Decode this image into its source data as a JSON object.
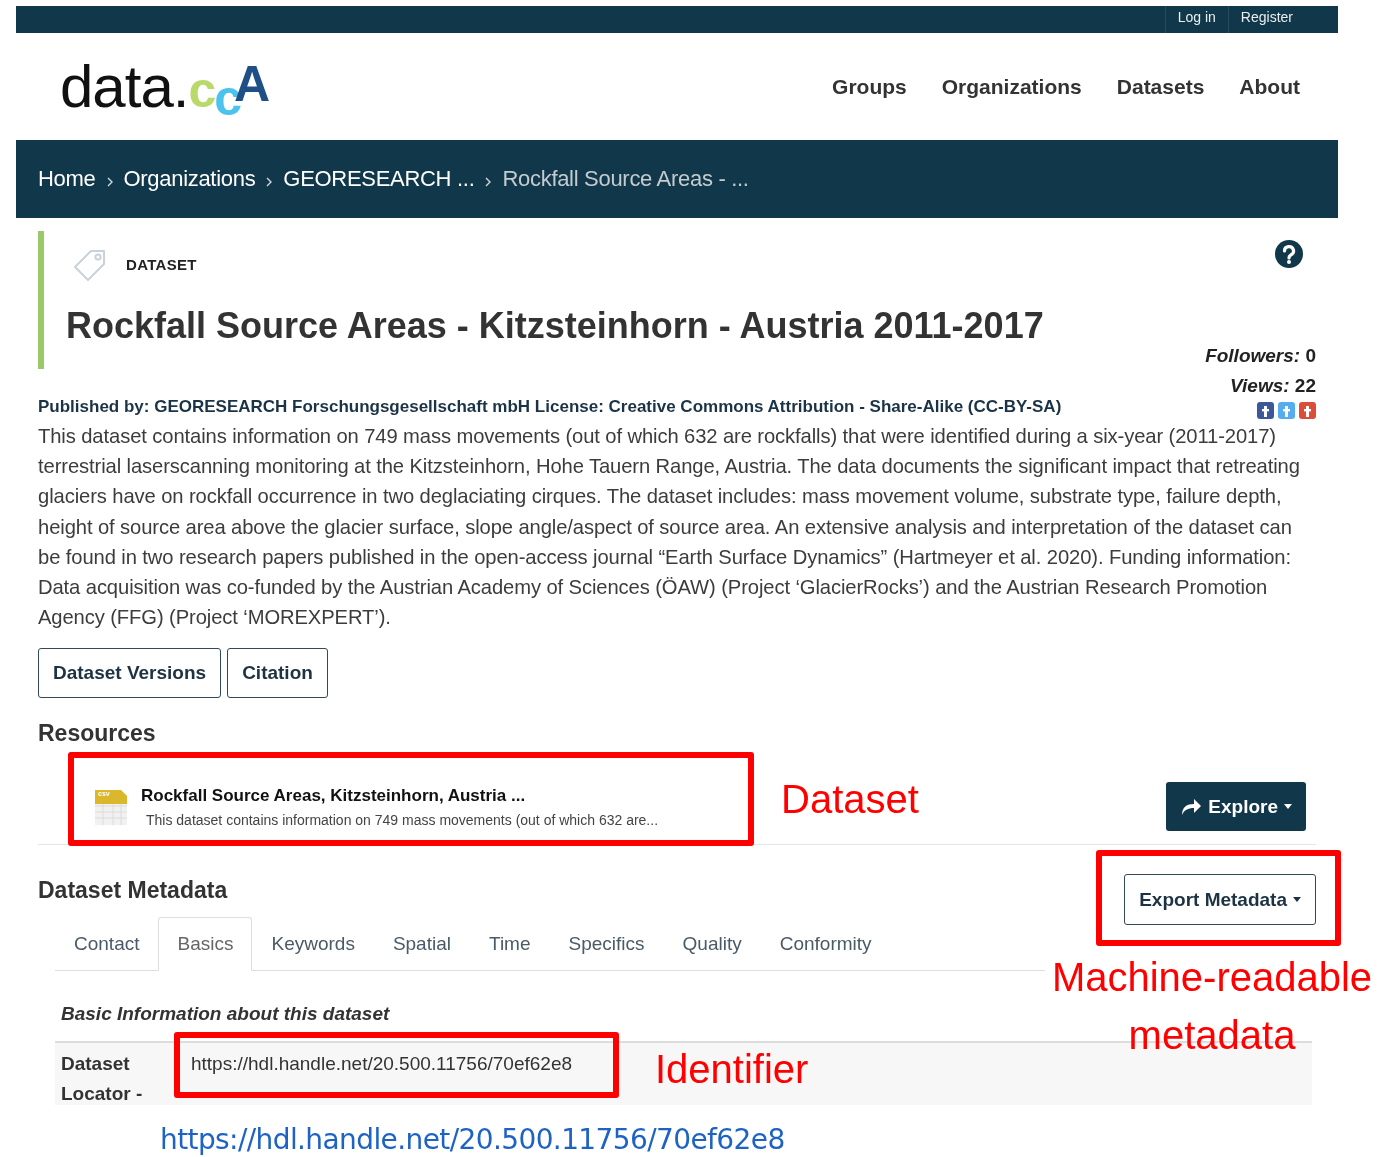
{
  "top_bar": {
    "links": [
      "Log in",
      "Register"
    ]
  },
  "header": {
    "logo": {
      "text": "data.",
      "mark": "ccA"
    },
    "nav": [
      "Groups",
      "Organizations",
      "Datasets",
      "About"
    ]
  },
  "breadcrumb": [
    {
      "label": "Home",
      "current": false
    },
    {
      "label": "Organizations",
      "current": false
    },
    {
      "label": "GEORESEARCH ...",
      "current": false
    },
    {
      "label": "Rockfall Source Areas - ...",
      "current": true
    }
  ],
  "dataset": {
    "type_label": "DATASET",
    "title": "Rockfall Source Areas - Kitzsteinhorn - Austria 2011-2017",
    "stats": [
      "*Followers:* 0",
      "*Views:* 22"
    ],
    "published": "Published by: GEORESEARCH Forschungsgesellschaft mbH License: Creative Commons Attribution - Share-Alike (CC-BY-SA)",
    "description": "This dataset contains information on 749 mass movements (out of which 632 are rockfalls) that were identified during a six-year (2011-2017) terrestrial laserscanning monitoring at the Kitzsteinhorn, Hohe Tauern Range, Austria. The data documents the significant impact that retreating glaciers have on rockfall occurrence in two deglaciating cirques. The dataset includes: mass movement volume, substrate type, failure depth, height of source area above the glacier surface, slope angle/aspect of source area. An extensive analysis and interpretation of the dataset can be found in two research papers published in the open-access journal “Earth Surface Dynamics” (Hartmeyer et al. 2020). Funding information: Data acquisition was co-funded by the Austrian Academy of Sciences (ÖAW) (Project ‘GlacierRocks’) and the Austrian Research Promotion Agency (FFG) (Project ‘MOREXPERT’).",
    "buttons": [
      "Dataset Versions",
      "Citation"
    ]
  },
  "resources": {
    "heading": "Resources",
    "items": [
      {
        "format": "csv",
        "name": "Rockfall Source Areas, Kitzsteinhorn, Austria ...",
        "description": "This dataset contains information on 749 mass movements (out of which 632 are..."
      }
    ],
    "explore_button": "Explore"
  },
  "metadata": {
    "heading": "Dataset Metadata",
    "export_button": "Export Metadata",
    "tabs": [
      {
        "label": "Contact",
        "selected": false
      },
      {
        "label": "Basics",
        "selected": true
      },
      {
        "label": "Keywords",
        "selected": false
      },
      {
        "label": "Spatial",
        "selected": false
      },
      {
        "label": "Time",
        "selected": false
      },
      {
        "label": "Specifics",
        "selected": false
      },
      {
        "label": "Quality",
        "selected": false
      },
      {
        "label": "Conformity",
        "selected": false
      }
    ],
    "section_title": "Basic Information about this dataset",
    "rows": [
      {
        "label": "Dataset Locator -",
        "value": "https://hdl.handle.net/20.500.11756/70ef62e8"
      }
    ]
  },
  "annotations": [
    {
      "label": "Dataset"
    },
    {
      "label": "Machine-readable metadata"
    },
    {
      "label": "Identifier"
    }
  ],
  "link_caption": "https://hdl.handle.net/20.500.11756/70ef62e8"
}
